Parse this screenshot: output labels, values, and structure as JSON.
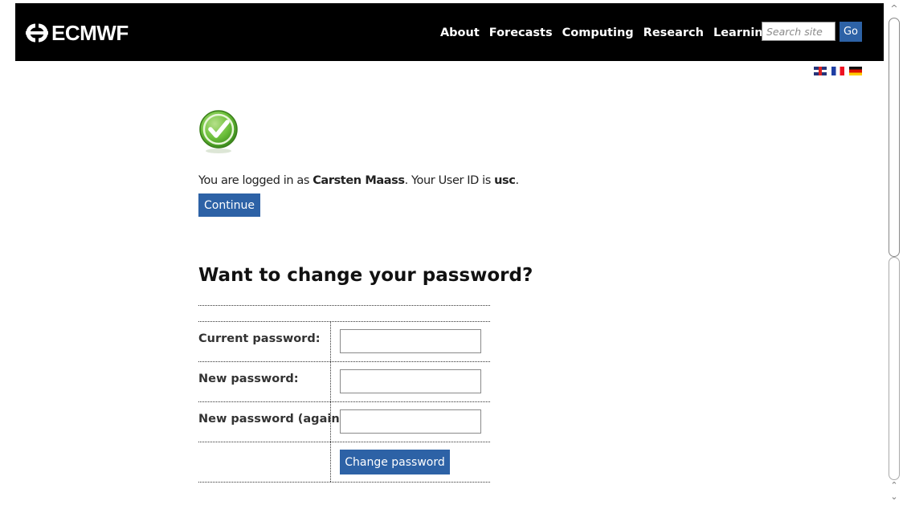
{
  "header": {
    "logo_text": "ECMWF",
    "nav": [
      {
        "label": "About"
      },
      {
        "label": "Forecasts"
      },
      {
        "label": "Computing"
      },
      {
        "label": "Research"
      },
      {
        "label": "Learning"
      }
    ],
    "search_placeholder": "Search site",
    "search_button": "Go"
  },
  "languages": [
    "English",
    "Français",
    "Deutsch"
  ],
  "login": {
    "status_icon": "check-circle-icon",
    "prefix": "You are logged in as ",
    "user_name": "Carsten Maass",
    "middle": ". Your User ID is ",
    "user_id": "usc",
    "suffix": ".",
    "continue_label": "Continue"
  },
  "password_form": {
    "title": "Want to change your password?",
    "current_label": "Current password:",
    "new_label": "New password:",
    "again_label": "New password (again):",
    "submit_label": "Change password"
  },
  "colors": {
    "header_bg": "#000000",
    "button_bg": "#2d62a6",
    "check_green": "#6cbf3a"
  }
}
